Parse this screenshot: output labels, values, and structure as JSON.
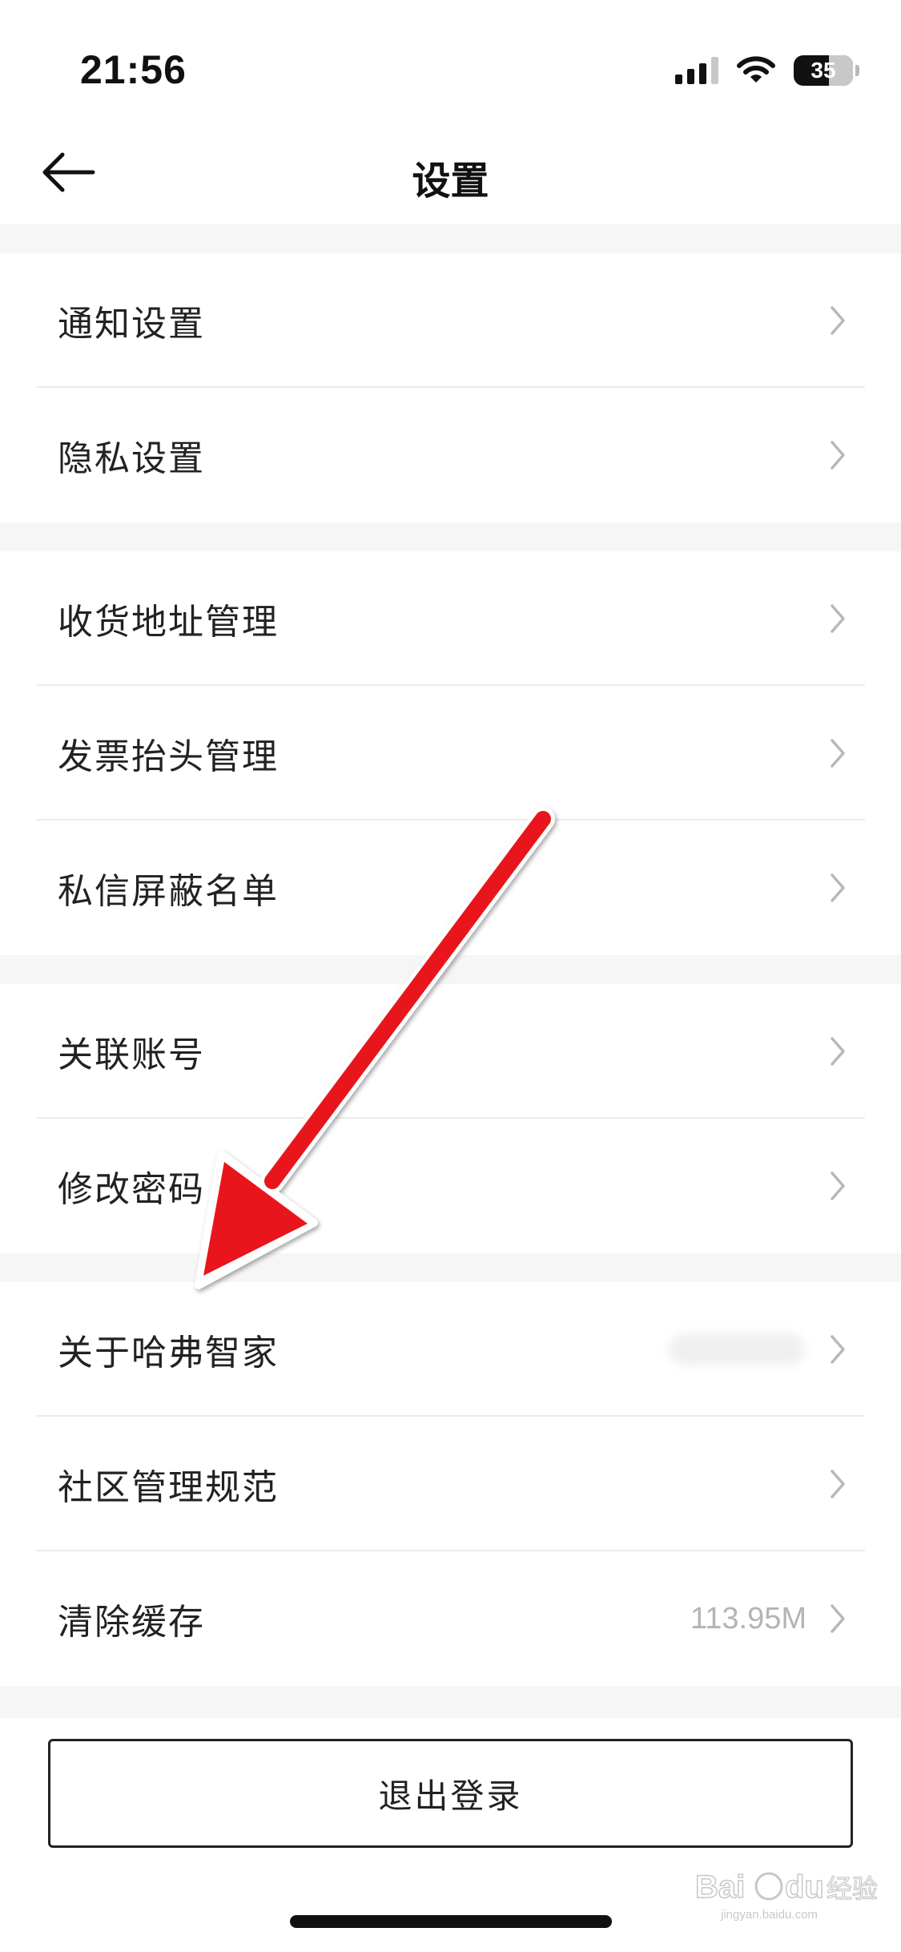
{
  "status_bar": {
    "time": "21:56",
    "battery": "35",
    "icons": [
      "signal-icon",
      "wifi-icon",
      "battery-icon"
    ]
  },
  "nav": {
    "title": "设置",
    "back_icon": "arrow-left-icon"
  },
  "groups": [
    {
      "items": [
        {
          "label": "通知设置"
        },
        {
          "label": "隐私设置"
        }
      ]
    },
    {
      "items": [
        {
          "label": "收货地址管理"
        },
        {
          "label": "发票抬头管理"
        },
        {
          "label": "私信屏蔽名单"
        }
      ]
    },
    {
      "items": [
        {
          "label": "关联账号"
        },
        {
          "label": "修改密码"
        }
      ]
    },
    {
      "items": [
        {
          "label": "关于哈弗智家",
          "value_blurred": true
        },
        {
          "label": "社区管理规范"
        },
        {
          "label": "清除缓存",
          "value": "113.95M"
        }
      ]
    }
  ],
  "logout": {
    "label": "退出登录"
  },
  "annotation": {
    "color": "#e8141b",
    "icon": "red-arrow-annotation"
  },
  "watermark": {
    "text": "Baidu 经验",
    "sub": "jingyan.baidu.com"
  }
}
